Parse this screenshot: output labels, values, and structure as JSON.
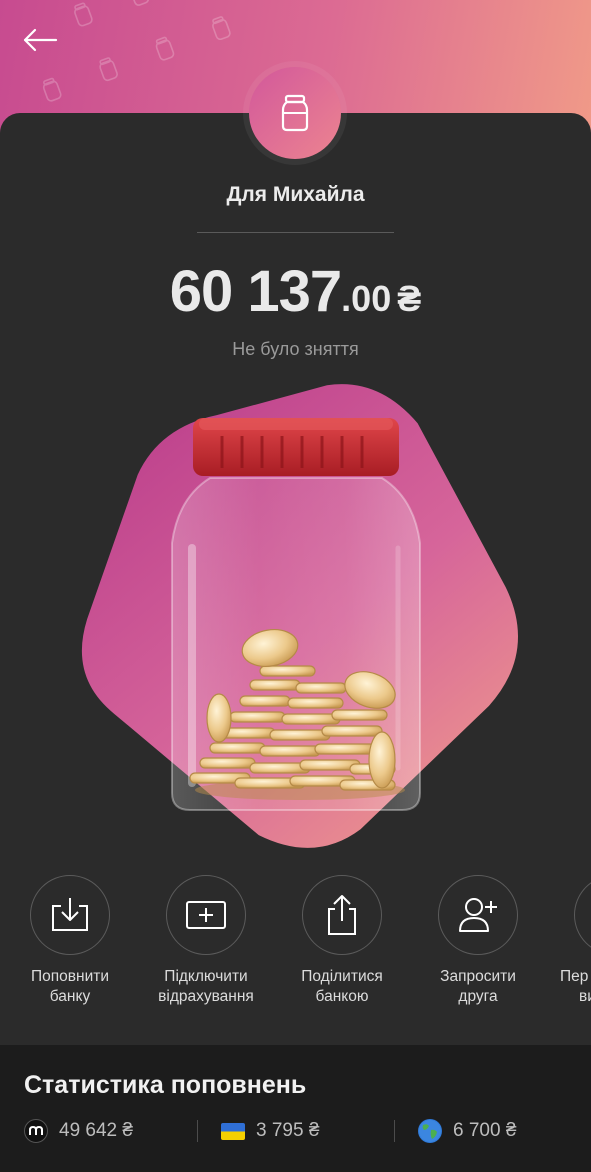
{
  "header": {
    "back_icon": "arrow-left-icon"
  },
  "jar": {
    "badge_icon": "jar-icon",
    "name": "Для Михайла",
    "balance_int": "60 137",
    "balance_dec": ".00",
    "currency": "₴",
    "status": "Не було зняття"
  },
  "actions": [
    {
      "icon": "download-tray-icon",
      "line1": "Поповнити",
      "line2": "банку"
    },
    {
      "icon": "card-plus-icon",
      "line1": "Підключити",
      "line2": "відрахування"
    },
    {
      "icon": "share-icon",
      "line1": "Поділитися",
      "line2": "банкою"
    },
    {
      "icon": "add-user-icon",
      "line1": "Запросити",
      "line2": "друга"
    },
    {
      "icon": "more-action-icon",
      "line1": "Пер",
      "line2": "ви"
    }
  ],
  "stats": {
    "title": "Статистика поповнень",
    "items": [
      {
        "icon": "monobank-icon",
        "value": "49 642 ₴"
      },
      {
        "icon": "ukraine-flag-icon",
        "value": "3 795 ₴"
      },
      {
        "icon": "globe-icon",
        "value": "6 700 ₴"
      }
    ]
  },
  "colors": {
    "accent_pink": "#d2589b",
    "accent_peach": "#f09a88",
    "lid_red": "#c4282e",
    "coin_gold": "#e8c98a"
  }
}
